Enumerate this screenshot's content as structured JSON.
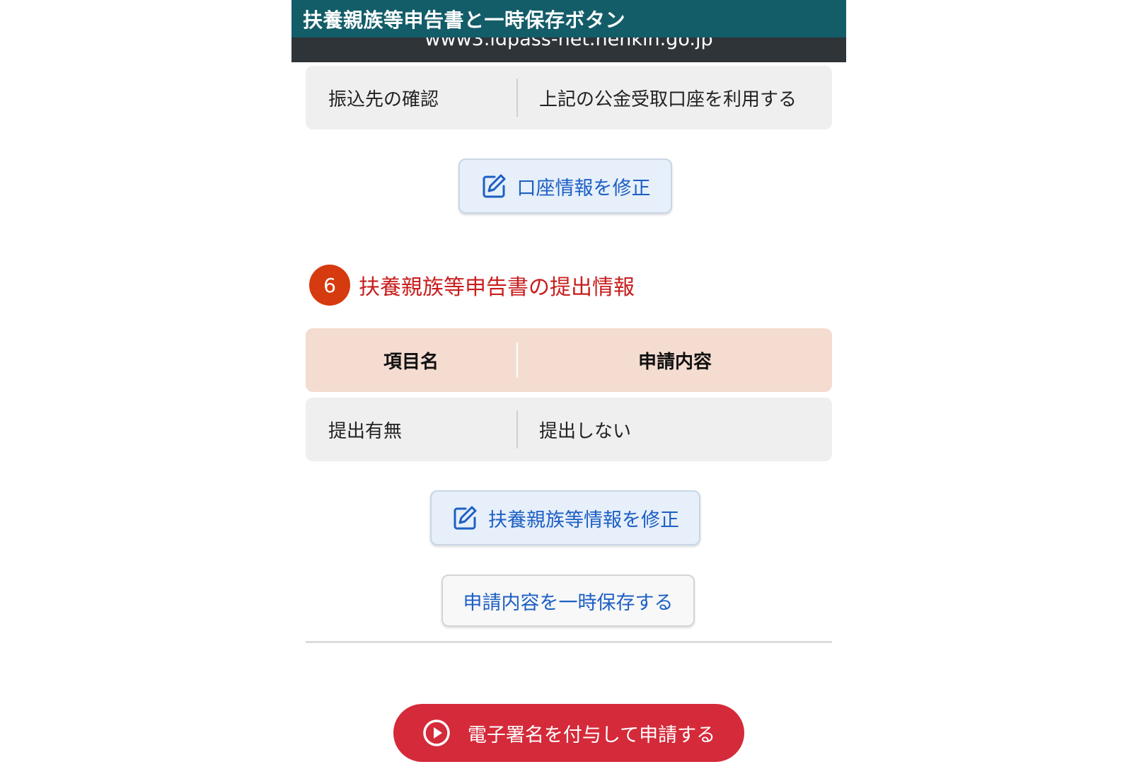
{
  "caption": "扶養親族等申告書と一時保存ボタン",
  "browser": {
    "url": "www3.idpass-net.nenkin.go.jp"
  },
  "payee": {
    "label": "振込先の確認",
    "value": "上記の公金受取口座を利用する",
    "edit_button": "口座情報を修正",
    "edit_icon": "edit-icon"
  },
  "section6": {
    "step_number": "6",
    "title": "扶養親族等申告書の提出情報",
    "table": {
      "headers": [
        "項目名",
        "申請内容"
      ],
      "rows": [
        {
          "label": "提出有無",
          "value": "提出しない"
        }
      ]
    },
    "edit_button": "扶養親族等情報を修正",
    "edit_icon": "edit-icon"
  },
  "save_button": "申請内容を一時保存する",
  "submit": {
    "label": "電子署名を付与して申請する",
    "icon": "play-circle-icon"
  },
  "colors": {
    "caption_bg": "#135d69",
    "url_bar_bg": "#2f3438",
    "accent_red": "#c81e1e",
    "badge_bg": "#d63a0f",
    "submit_bg": "#d42a3a",
    "link_blue": "#1d5fc4",
    "table_header_bg": "#f4dcd0",
    "row_bg": "#efefef"
  }
}
